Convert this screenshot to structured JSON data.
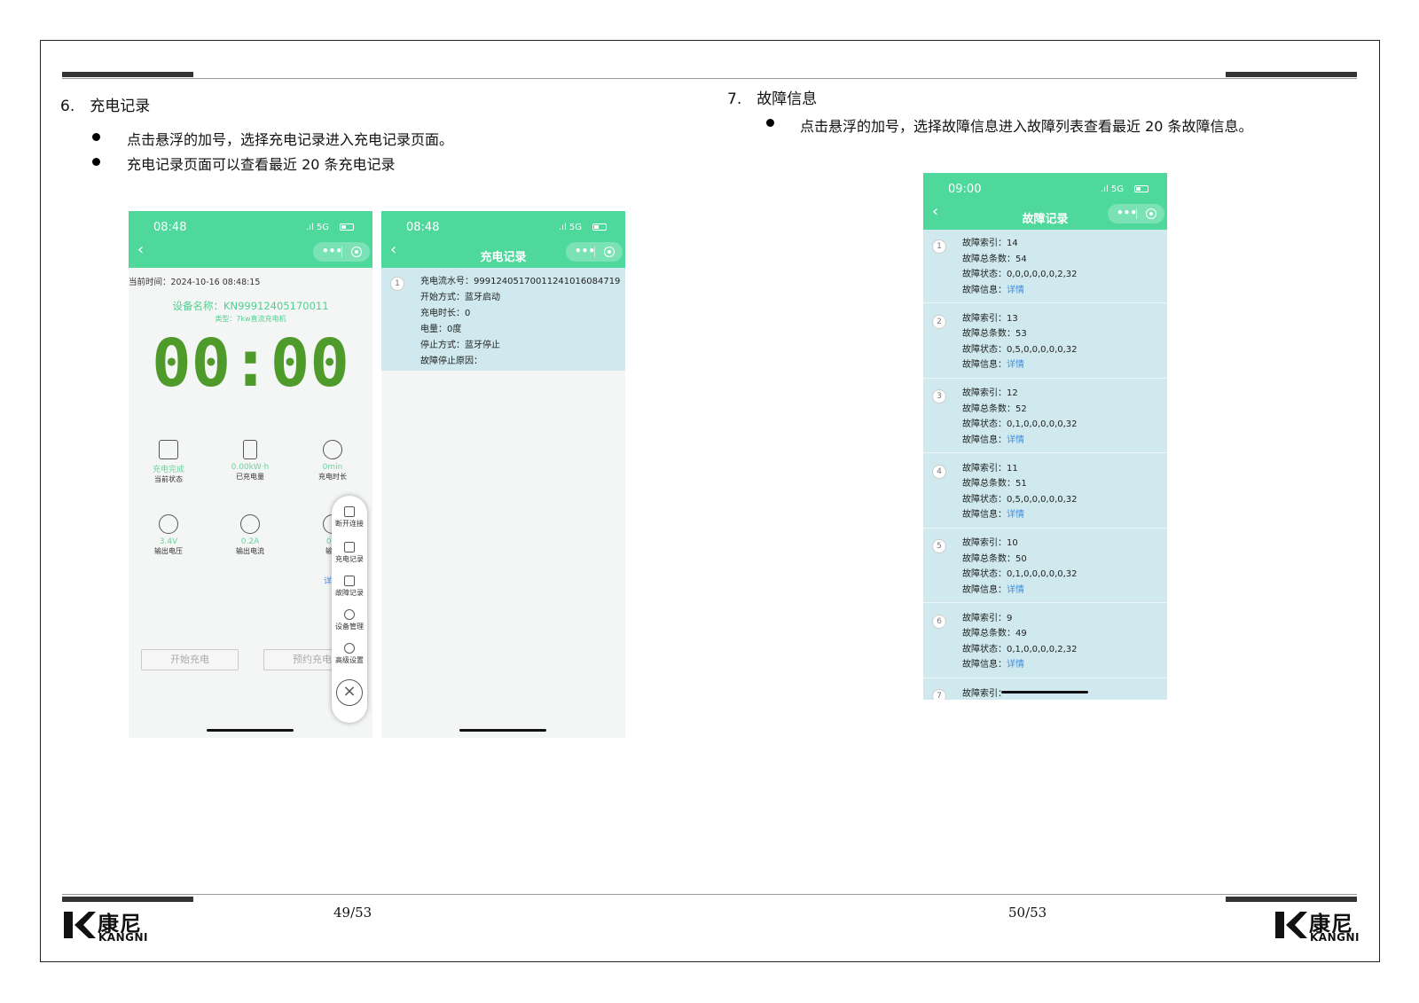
{
  "left_page": {
    "section_title": "6.　充电记录",
    "bullets": [
      "点击悬浮的加号，选择充电记录进入充电记录页面。",
      "充电记录页面可以查看最近 20 条充电记录"
    ],
    "page_number": "49/53"
  },
  "right_page": {
    "section_title": "7.　故障信息",
    "bullets": [
      "点击悬浮的加号，选择故障信息进入故障列表查看最近 20 条故障信息。"
    ],
    "page_number": "50/53"
  },
  "logo": {
    "cn": "康尼",
    "en": "KANGNI"
  },
  "phone1": {
    "time": "08:48",
    "signal": "5G",
    "current_time": "当前时间：2024-10-16 08:48:15",
    "device_name": "设备名称：KN99912405170011",
    "device_type": "类型：7kw直流充电机",
    "timer": "00:00",
    "stats_row1": [
      {
        "value": "充电完成",
        "label": "当前状态",
        "icon": "waveform-icon"
      },
      {
        "value": "0.00kW·h",
        "label": "已充电量",
        "icon": "battery-icon"
      },
      {
        "value": "0min",
        "label": "充电时长",
        "icon": "clock-icon"
      }
    ],
    "stats_row2": [
      {
        "value": "3.4V",
        "label": "输出电压",
        "icon": "voltage-icon"
      },
      {
        "value": "0.2A",
        "label": "输出电流",
        "icon": "current-icon"
      },
      {
        "value": "0.6",
        "label": "输出",
        "icon": "power-icon"
      }
    ],
    "detail_partial": "详",
    "start_button": "开始充电",
    "schedule_button": "预约充电",
    "fab_items": [
      "断开连接",
      "充电记录",
      "故障记录",
      "设备管理",
      "高级设置"
    ]
  },
  "phone2": {
    "time": "08:48",
    "signal": "5G",
    "title": "充电记录",
    "record": {
      "index": "1",
      "lines": [
        "充电流水号：99912405170011241016084719",
        "开始方式：蓝牙启动",
        "充电时长：0",
        "电量：0度",
        "停止方式：蓝牙停止",
        "故障停止原因："
      ]
    }
  },
  "phone3": {
    "time": "09:00",
    "signal": "5G",
    "title": "故障记录",
    "labels": {
      "index": "故障索引：",
      "total": "故障总条数：",
      "status": "故障状态：",
      "info": "故障信息："
    },
    "detail_link": "详情",
    "faults": [
      {
        "n": "1",
        "index": "14",
        "total": "54",
        "status": "0,0,0,0,0,0,2,32"
      },
      {
        "n": "2",
        "index": "13",
        "total": "53",
        "status": "0,5,0,0,0,0,0,32"
      },
      {
        "n": "3",
        "index": "12",
        "total": "52",
        "status": "0,1,0,0,0,0,0,32"
      },
      {
        "n": "4",
        "index": "11",
        "total": "51",
        "status": "0,5,0,0,0,0,0,32"
      },
      {
        "n": "5",
        "index": "10",
        "total": "50",
        "status": "0,1,0,0,0,0,0,32"
      },
      {
        "n": "6",
        "index": "9",
        "total": "49",
        "status": "0,1,0,0,0,0,2,32"
      }
    ],
    "partial_item": {
      "n": "7",
      "label": "故障索引："
    }
  }
}
